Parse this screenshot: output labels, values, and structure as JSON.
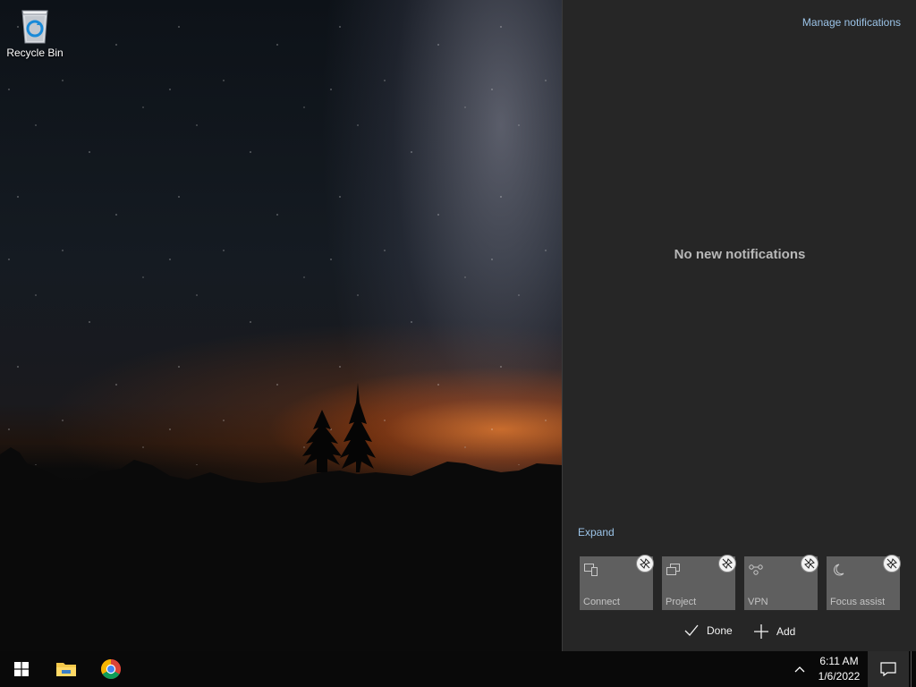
{
  "desktop": {
    "icons": [
      {
        "label": "Recycle Bin",
        "icon": "recycle-bin-icon"
      }
    ]
  },
  "action_center": {
    "manage_label": "Manage notifications",
    "empty_message": "No new notifications",
    "expand_label": "Expand",
    "quick_actions": [
      {
        "label": "Connect",
        "icon": "connect-icon"
      },
      {
        "label": "Project",
        "icon": "project-icon"
      },
      {
        "label": "VPN",
        "icon": "vpn-icon"
      },
      {
        "label": "Focus assist",
        "icon": "moon-icon"
      }
    ],
    "done_label": "Done",
    "add_label": "Add"
  },
  "taskbar": {
    "pinned": [
      {
        "name": "start",
        "icon": "windows-logo-icon"
      },
      {
        "name": "file-explorer",
        "icon": "folder-icon"
      },
      {
        "name": "chrome",
        "icon": "chrome-icon"
      }
    ],
    "time": "6:11 AM",
    "date": "1/6/2022"
  },
  "colors": {
    "panel_bg": "#262626",
    "link": "#9cc4e8",
    "tile_bg": "#5f5f5f",
    "taskbar_bg": "#090909"
  }
}
